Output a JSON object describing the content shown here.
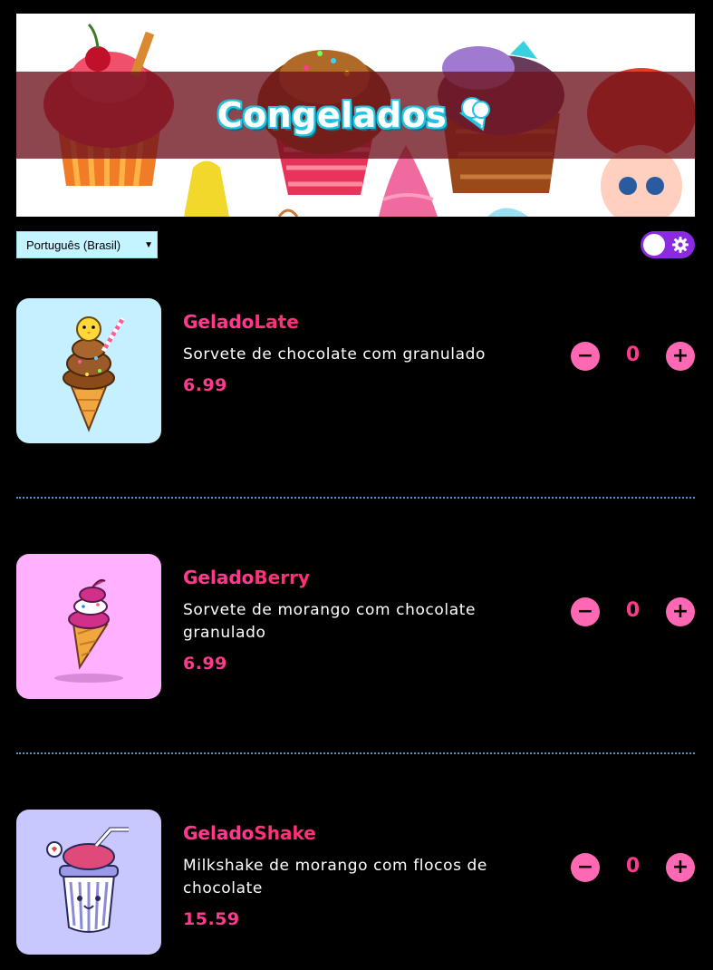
{
  "banner": {
    "title": "Congelados",
    "icon": "ice-cream-icon"
  },
  "language_select": {
    "selected": "Português (Brasil)"
  },
  "theme_toggle": {
    "icon": "gear-icon",
    "state": "off"
  },
  "products": [
    {
      "name_part1": "Gelado",
      "name_part2": "Late",
      "description": "Sorvete de chocolate com granulado",
      "price": "6.99",
      "quantity": "0",
      "thumb_bg": "#c4f0ff"
    },
    {
      "name_part1": "Gelado",
      "name_part2": "Berry",
      "description": "Sorvete de morango com chocolate granulado",
      "price": "6.99",
      "quantity": "0",
      "thumb_bg": "#ffb0ff"
    },
    {
      "name_part1": "Gelado",
      "name_part2": "Shake",
      "description": "Milkshake de morango com flocos de chocolate",
      "price": "15.59",
      "quantity": "0",
      "thumb_bg": "#c8c8ff"
    }
  ],
  "qty_controls": {
    "minus": "−",
    "plus": "+"
  },
  "colors": {
    "accent": "#ff3a8c",
    "button": "#ff69b4",
    "toggle": "#8a2be2",
    "select_bg": "#c4f4ff",
    "divider": "#5a8fd6"
  }
}
